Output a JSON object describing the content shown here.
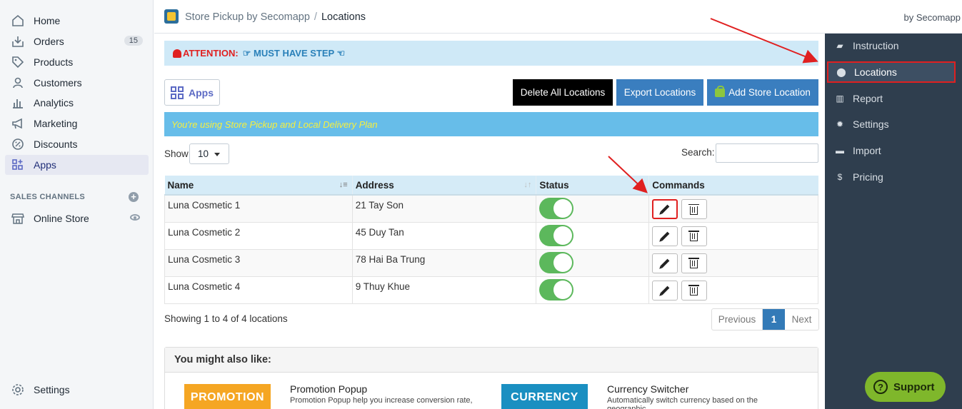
{
  "nav": {
    "items": [
      {
        "label": "Home",
        "icon": "home-icon"
      },
      {
        "label": "Orders",
        "icon": "orders-icon",
        "badge": "15"
      },
      {
        "label": "Products",
        "icon": "tag-icon"
      },
      {
        "label": "Customers",
        "icon": "person-icon"
      },
      {
        "label": "Analytics",
        "icon": "bar-chart-icon"
      },
      {
        "label": "Marketing",
        "icon": "megaphone-icon"
      },
      {
        "label": "Discounts",
        "icon": "discount-icon"
      },
      {
        "label": "Apps",
        "icon": "apps-icon",
        "active": true
      }
    ],
    "section": "SALES CHANNELS",
    "online_store": "Online Store",
    "settings": "Settings"
  },
  "topbar": {
    "app_name": "Store Pickup by Secomapp",
    "separator": "/",
    "page": "Locations",
    "byline": "by Secomapp"
  },
  "rightnav": {
    "items": [
      {
        "label": "Instruction",
        "icon": "book-icon"
      },
      {
        "label": "Locations",
        "icon": "map-pin-icon",
        "active": true
      },
      {
        "label": "Report",
        "icon": "bar-chart-icon"
      },
      {
        "label": "Settings",
        "icon": "gear-icon"
      },
      {
        "label": "Import",
        "icon": "folder-open-icon"
      },
      {
        "label": "Pricing",
        "icon": "dollar-icon"
      }
    ],
    "support": "Support"
  },
  "attention": {
    "warn": "ATTENTION:",
    "must": "☞ MUST HAVE STEP ☜"
  },
  "toolbar": {
    "apps": "Apps",
    "delete_all": "Delete All Locations",
    "export": "Export Locations",
    "add": "Add Store Location"
  },
  "plan_text": "You're using Store Pickup and Local Delivery Plan",
  "table_controls": {
    "show_label": "Show",
    "show_value": "10",
    "search_label": "Search:"
  },
  "table": {
    "headers": [
      "Name",
      "Address",
      "Status",
      "Commands"
    ],
    "rows": [
      {
        "name": "Luna Cosmetic 1",
        "address": "21 Tay Son",
        "enabled": true
      },
      {
        "name": "Luna Cosmetic 2",
        "address": "45 Duy Tan",
        "enabled": true
      },
      {
        "name": "Luna Cosmetic 3",
        "address": "78 Hai Ba Trung",
        "enabled": true
      },
      {
        "name": "Luna Cosmetic 4",
        "address": "9 Thuy Khue",
        "enabled": true
      }
    ]
  },
  "pagination": {
    "info": "Showing 1 to 4 of 4 locations",
    "prev": "Previous",
    "current": "1",
    "next": "Next"
  },
  "also": {
    "header": "You might also like:",
    "promo_img": "PROMOTION",
    "promo_title": "Promotion Popup",
    "promo_desc": "Promotion Popup help you increase conversion rate,",
    "curr_img": "CURRENCY",
    "curr_title": "Currency Switcher",
    "curr_desc": "Automatically switch currency based on the geographic"
  },
  "colors": {
    "accent": "#5c6ac4",
    "sidebar_dark": "#2f3e4e",
    "highlight": "#e02020",
    "toggle_on": "#5cb85c"
  }
}
